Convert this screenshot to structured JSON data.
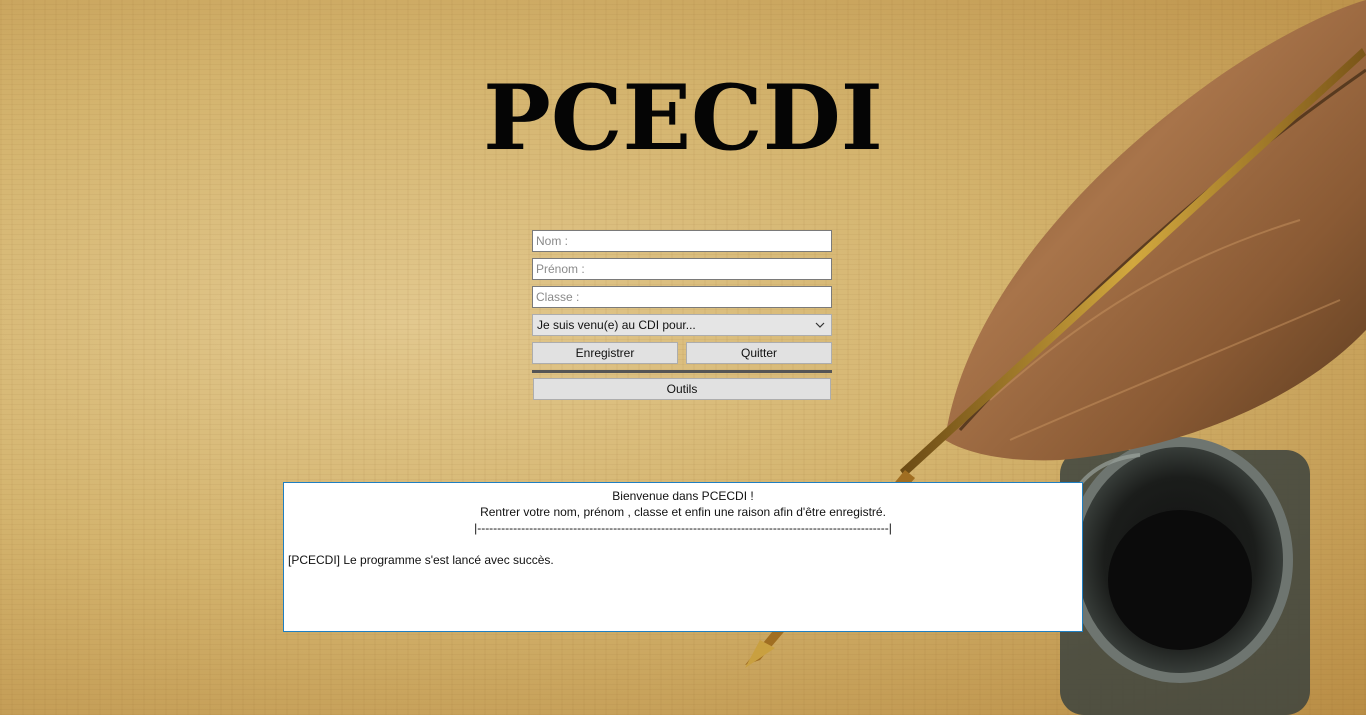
{
  "app": {
    "title": "PCECDI"
  },
  "form": {
    "nom_placeholder": "Nom :",
    "prenom_placeholder": "Prénom :",
    "classe_placeholder": "Classe :",
    "reason_select_value": "Je suis venu(e) au CDI pour...",
    "register_label": "Enregistrer",
    "quit_label": "Quitter",
    "tools_label": "Outils"
  },
  "console": {
    "welcome_line": "Bienvenue dans PCECDI !",
    "instructions_line": "Rentrer votre nom, prénom , classe et enfin une raison afin d'être enregistré.",
    "divider_line": "|-------------------------------------------------------------------------------------------------------|",
    "log_line": "[PCECDI] Le programme s'est lancé avec succès."
  },
  "icons": {
    "select_arrow": "chevron-down-icon"
  },
  "colors": {
    "console_border": "#1f7fc2",
    "title_color": "#050505"
  }
}
